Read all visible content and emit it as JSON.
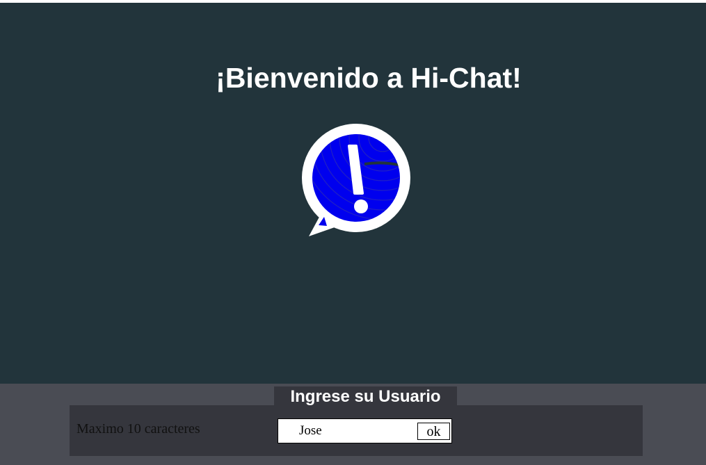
{
  "window": {
    "title": "¡Bienvenido a Hi-Chat!",
    "background_color": "#22343b"
  },
  "logo": {
    "icon": "chat-bubble-exclamation-icon",
    "fill_color": "#0000ee",
    "outline_color": "#ffffff"
  },
  "login": {
    "prompt": "Ingrese su Usuario",
    "hint": "Maximo 10 caracteres",
    "username_value": "Jose",
    "ok_label": "ok",
    "panel_color": "#4a4c54",
    "row_color": "#35363d"
  }
}
